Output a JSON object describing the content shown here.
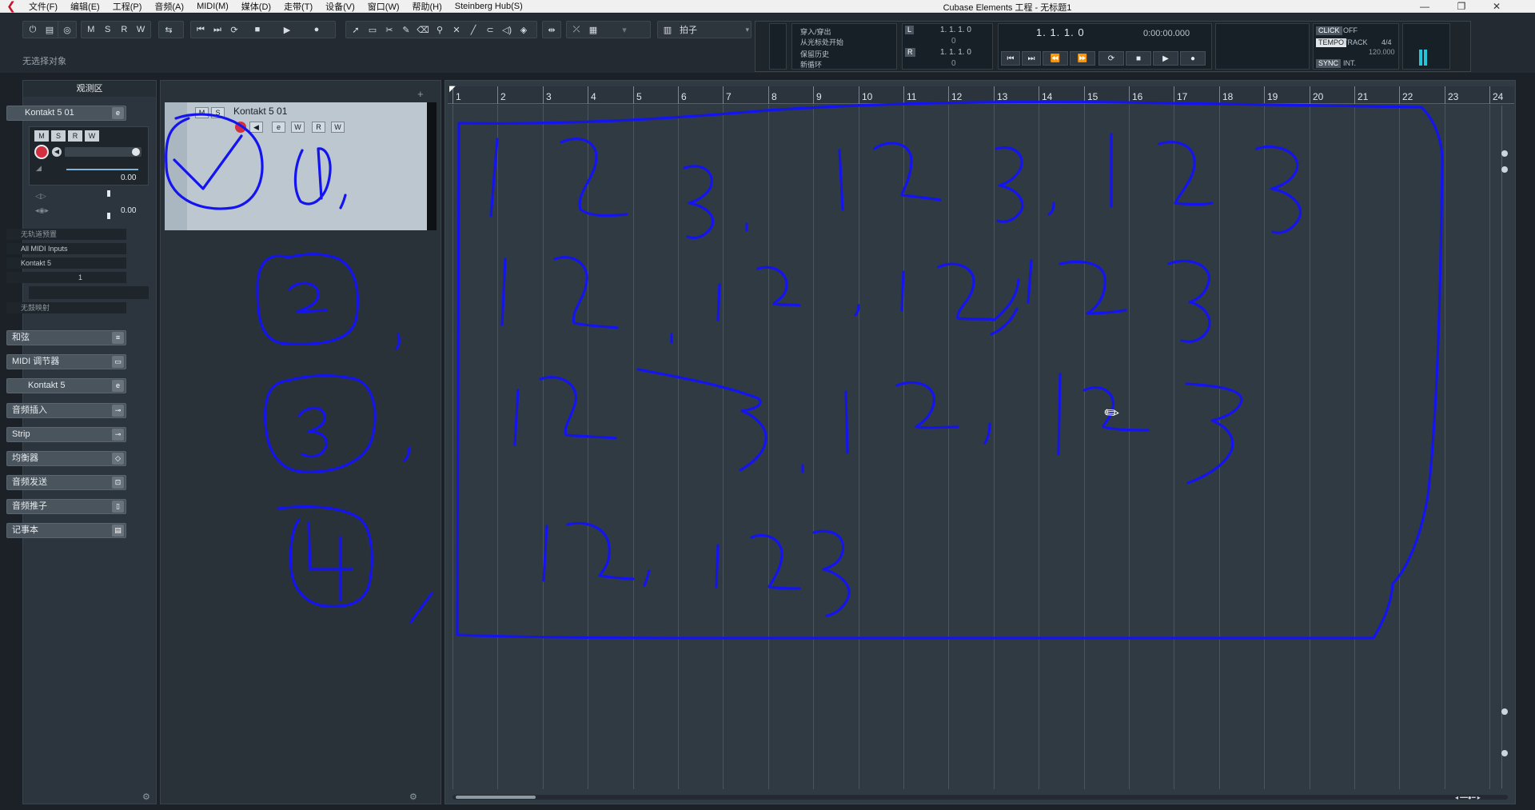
{
  "app": {
    "window_title": "Cubase Elements 工程 - 无标题1",
    "menu": [
      "文件(F)",
      "编辑(E)",
      "工程(P)",
      "音频(A)",
      "MIDI(M)",
      "媒体(D)",
      "走带(T)",
      "设备(V)",
      "窗口(W)",
      "帮助(H)",
      "Steinberg Hub(S)"
    ],
    "window_controls": {
      "minimize": "—",
      "restore": "❐",
      "close": "✕"
    }
  },
  "toolbar": {
    "msrw": [
      "M",
      "S",
      "R",
      "W"
    ],
    "grid_type": "拍子",
    "status_text": "无选择对象"
  },
  "transport": {
    "labels": [
      "穿入/穿出",
      "从光标处开始",
      "保留历史",
      "新循环"
    ],
    "locator_left": "1. 1. 1.   0",
    "locator_right": "1. 1. 1.   0",
    "zeros": [
      "0",
      "0"
    ],
    "position_bars": "1.  1.  1.   0",
    "position_time": "0:00:00.000",
    "click_label": "CLICK",
    "click_value": "OFF",
    "tempo_label": "TEMPO",
    "tempo_mode": "TRACK",
    "signature": "4/4",
    "tempo_value": "120.000",
    "sync_label": "SYNC",
    "sync_value": "INT."
  },
  "inspector": {
    "title": "观测区",
    "track_name": "Kontakt 5 01",
    "msrw": [
      "M",
      "S",
      "R",
      "W"
    ],
    "volume": "0.00",
    "pan": "0.00",
    "routing": [
      "无轨道预置",
      "All MIDI Inputs",
      "Kontakt 5"
    ],
    "channel": "1",
    "no_drum": "无鼓映射",
    "sections": [
      "和弦",
      "MIDI 调节器",
      "Kontakt 5",
      "音频插入",
      "Strip",
      "均衡器",
      "音频发送",
      "音频推子",
      "记事本"
    ]
  },
  "tracklist": {
    "track_name": "Kontakt 5 01",
    "buttons": [
      "M",
      "S",
      "e",
      "W",
      "R",
      "W"
    ]
  },
  "ruler": {
    "bars": [
      "1",
      "2",
      "3",
      "4",
      "5",
      "6",
      "7",
      "8",
      "9",
      "10",
      "11",
      "12",
      "13",
      "14",
      "15",
      "16",
      "17",
      "18",
      "19",
      "20",
      "21",
      "22",
      "23",
      "24"
    ]
  },
  "annotation": {
    "description_color": "#1414f0"
  },
  "colors": {
    "accent": "#c8102e",
    "ink": "#1414f0",
    "background": "#303a43"
  }
}
